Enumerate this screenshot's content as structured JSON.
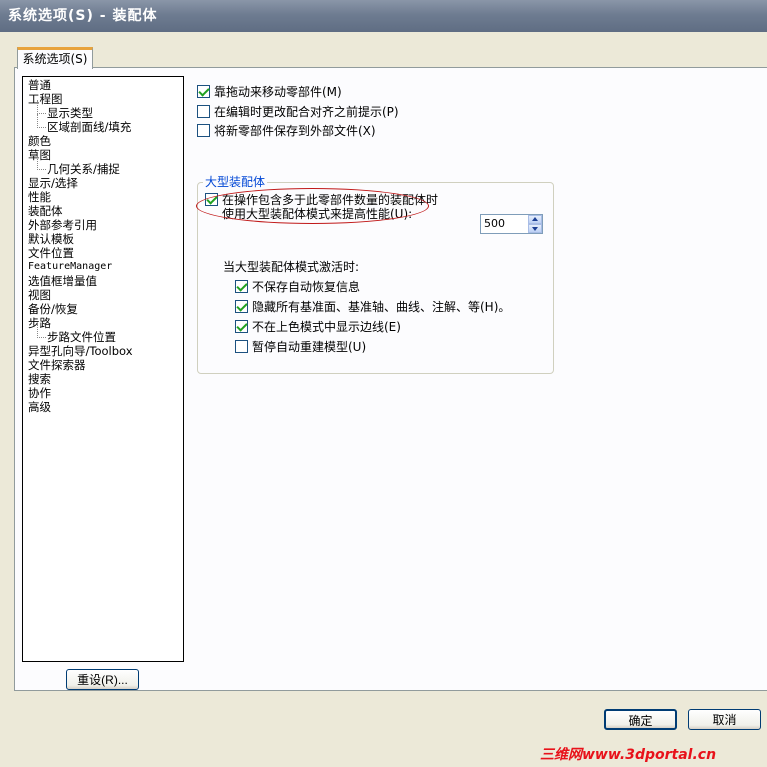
{
  "window": {
    "title": "系统选项(S) - 装配体"
  },
  "tab": {
    "label": "系统选项(S)"
  },
  "tree": {
    "items": [
      {
        "label": "普通",
        "level": 0
      },
      {
        "label": "工程图",
        "level": 0
      },
      {
        "label": "显示类型",
        "level": 1
      },
      {
        "label": "区域剖面线/填充",
        "level": 1
      },
      {
        "label": "颜色",
        "level": 0
      },
      {
        "label": "草图",
        "level": 0
      },
      {
        "label": "几何关系/捕捉",
        "level": 1
      },
      {
        "label": "显示/选择",
        "level": 0
      },
      {
        "label": "性能",
        "level": 0
      },
      {
        "label": "装配体",
        "level": 0,
        "selected": true
      },
      {
        "label": "外部参考引用",
        "level": 0
      },
      {
        "label": "默认模板",
        "level": 0
      },
      {
        "label": "文件位置",
        "level": 0
      },
      {
        "label": "FeatureManager",
        "level": 0
      },
      {
        "label": "选值框增量值",
        "level": 0
      },
      {
        "label": "视图",
        "level": 0
      },
      {
        "label": "备份/恢复",
        "level": 0
      },
      {
        "label": "步路",
        "level": 0
      },
      {
        "label": "步路文件位置",
        "level": 1
      },
      {
        "label": "异型孔向导/Toolbox",
        "level": 0
      },
      {
        "label": "文件探索器",
        "level": 0
      },
      {
        "label": "搜索",
        "level": 0
      },
      {
        "label": "协作",
        "level": 0
      },
      {
        "label": "高级",
        "level": 0
      }
    ]
  },
  "options": {
    "drag_move": {
      "label": "靠拖动来移动零部件(M)",
      "checked": true
    },
    "prompt_before_mate_change": {
      "label": "在编辑时更改配合对齐之前提示(P)",
      "checked": false
    },
    "save_new_parts_external": {
      "label": "将新零部件保存到外部文件(X)",
      "checked": false
    }
  },
  "large_assembly": {
    "group_label": "大型装配体",
    "use_large_mode": {
      "label_line1": "在操作包含多于此零部件数量的装配体时",
      "label_line2": "使用大型装配体模式来提高性能(U):",
      "checked": true
    },
    "threshold_value": "500",
    "when_active_label": "当大型装配体模式激活时:",
    "active_options": [
      {
        "label": "不保存自动恢复信息",
        "checked": true
      },
      {
        "label": "隐藏所有基准面、基准轴、曲线、注解、等(H)。",
        "checked": true
      },
      {
        "label": "不在上色模式中显示边线(E)",
        "checked": true
      },
      {
        "label": "暂停自动重建模型(U)",
        "checked": false
      }
    ]
  },
  "buttons": {
    "reset": "重设(R)...",
    "ok": "确定",
    "cancel": "取消"
  },
  "watermark": "三维网www.3dportal.cn",
  "colors": {
    "accent_blue": "#0046d5",
    "check_green": "#21a121",
    "highlight_ellipse": "#c01818",
    "watermark_red": "#e8121a"
  }
}
